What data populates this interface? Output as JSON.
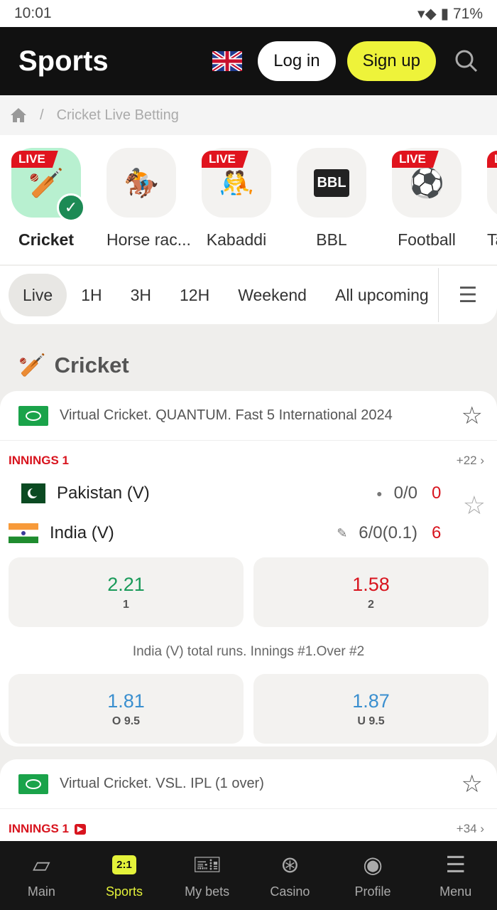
{
  "status": {
    "time": "10:01",
    "battery": "71%"
  },
  "header": {
    "title": "Sports",
    "login": "Log in",
    "signup": "Sign up"
  },
  "breadcrumb": {
    "sep": "/",
    "current": "Cricket Live Betting"
  },
  "sports": [
    {
      "label": "Cricket",
      "live": "LIVE",
      "icon": "🏏",
      "active": true
    },
    {
      "label": "Horse rac...",
      "live": "",
      "icon": "🏇"
    },
    {
      "label": "Kabaddi",
      "live": "LIVE",
      "icon": "🤼"
    },
    {
      "label": "BBL",
      "live": "",
      "icon": "BBL"
    },
    {
      "label": "Football",
      "live": "LIVE",
      "icon": "⚽"
    },
    {
      "label": "Tab",
      "live": "LIVE",
      "icon": ""
    }
  ],
  "tabs": [
    "Live",
    "1H",
    "3H",
    "12H",
    "Weekend",
    "All upcoming"
  ],
  "section": {
    "title": "Cricket"
  },
  "cards": [
    {
      "championship": "Virtual Cricket. QUANTUM. Fast 5 International 2024",
      "innings": "INNINGS 1",
      "more": "+22 ›",
      "teams": [
        {
          "name": "Pakistan (V)",
          "score": "0/0",
          "points": "0"
        },
        {
          "name": "India (V)",
          "score": "6/0(0.1)",
          "points": "6"
        }
      ],
      "odds": [
        {
          "value": "2.21",
          "label": "1",
          "color": "#1a9a5a"
        },
        {
          "value": "1.58",
          "label": "2",
          "color": "#d8141e"
        }
      ],
      "market": "India (V) total runs. Innings #1.Over #2",
      "market_odds": [
        {
          "value": "1.81",
          "label": "O 9.5",
          "color": "#3a8fcf"
        },
        {
          "value": "1.87",
          "label": "U 9.5",
          "color": "#3a8fcf"
        }
      ]
    },
    {
      "championship": "Virtual Cricket. VSL. IPL (1 over)",
      "innings": "INNINGS 1",
      "more": "+34 ›"
    }
  ],
  "nav": [
    {
      "label": "Main"
    },
    {
      "label": "Sports",
      "badge": "2:1"
    },
    {
      "label": "My bets"
    },
    {
      "label": "Casino"
    },
    {
      "label": "Profile"
    },
    {
      "label": "Menu"
    }
  ]
}
